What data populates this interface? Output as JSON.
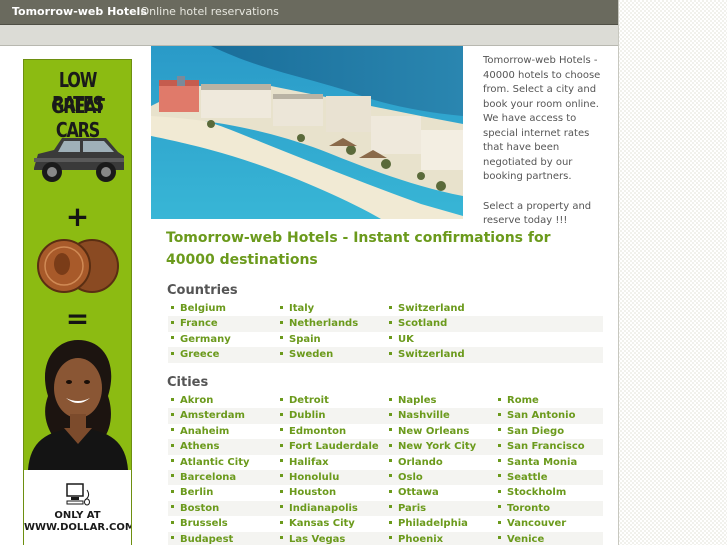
{
  "header": {
    "brand": "Tomorrow-web Hotels",
    "tagline": "- Online hotel reservations"
  },
  "ad": {
    "line1": "LOW RATES",
    "line2": "GREAT CARS",
    "plus": "+",
    "equals": "=",
    "footer1": "ONLY AT",
    "footer2": "WWW.DOLLAR.COM",
    "colors": {
      "background": "#8cbb12"
    }
  },
  "intro": {
    "paragraph1": "Tomorrow-web Hotels - 40000 hotels to choose from. Select a city and book your room online. We have access to special internet rates that have been negotiated by our booking partners.",
    "paragraph2": "Select a property and reserve today !!!"
  },
  "headline": "Tomorrow-web Hotels - Instant confirmations for 40000 destinations",
  "countries": {
    "title": "Countries",
    "rows": [
      [
        "Belgium",
        "Italy",
        "Switzerland",
        ""
      ],
      [
        "France",
        "Netherlands",
        "Scotland",
        ""
      ],
      [
        "Germany",
        "Spain",
        "UK",
        ""
      ],
      [
        "Greece",
        "Sweden",
        "Switzerland",
        ""
      ]
    ]
  },
  "cities": {
    "title": "Cities",
    "rows": [
      [
        "Akron",
        "Detroit",
        "Naples",
        "Rome"
      ],
      [
        "Amsterdam",
        "Dublin",
        "Nashville",
        "San Antonio"
      ],
      [
        "Anaheim",
        "Edmonton",
        "New Orleans",
        "San Diego"
      ],
      [
        "Athens",
        "Fort Lauderdale",
        "New York City",
        "San Francisco"
      ],
      [
        "Atlantic City",
        "Halifax",
        "Orlando",
        "Santa Monia"
      ],
      [
        "Barcelona",
        "Honolulu",
        "Oslo",
        "Seattle"
      ],
      [
        "Berlin",
        "Houston",
        "Ottawa",
        "Stockholm"
      ],
      [
        "Boston",
        "Indianapolis",
        "Paris",
        "Toronto"
      ],
      [
        "Brussels",
        "Kansas City",
        "Philadelphia",
        "Vancouver"
      ],
      [
        "Budapest",
        "Las Vegas",
        "Phoenix",
        "Venice"
      ]
    ]
  },
  "colors": {
    "link": "#6b9a1c",
    "topbar": "#6a6a5e",
    "text": "#555555"
  }
}
